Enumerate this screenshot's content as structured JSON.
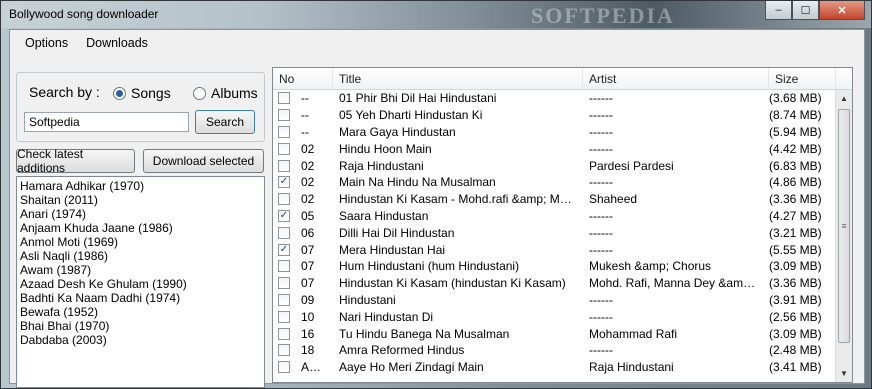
{
  "window": {
    "title": "Bollywood song downloader",
    "watermark": "SOFTPEDIA",
    "minimize": "–",
    "maximize": "☐",
    "close": "✕"
  },
  "menu": {
    "items": [
      "Options",
      "Downloads"
    ]
  },
  "search": {
    "label": "Search by :",
    "option_songs": "Songs",
    "option_albums": "Albums",
    "selected": "Songs",
    "value": "Softpedia",
    "button": "Search"
  },
  "actions": {
    "check_latest": "Check latest additions",
    "download_selected": "Download selected"
  },
  "albums": [
    "Hamara Adhikar (1970)",
    "Shaitan (2011)",
    "Anari (1974)",
    "Anjaam Khuda Jaane (1986)",
    "Anmol Moti (1969)",
    "Asli Naqli (1986)",
    "Awam (1987)",
    "Azaad Desh Ke Ghulam (1990)",
    "Badhti Ka Naam Dadhi (1974)",
    "Bewafa (1952)",
    "Bhai Bhai (1970)",
    "Dabdaba (2003)"
  ],
  "table": {
    "columns": [
      "No",
      "Title",
      "Artist",
      "Size"
    ],
    "rows": [
      {
        "checked": false,
        "no": "--",
        "title": "01 Phir Bhi Dil Hai Hindustani",
        "artist": "------",
        "size": "(3.68 MB)"
      },
      {
        "checked": false,
        "no": "--",
        "title": "05 Yeh Dharti Hindustan Ki",
        "artist": "------",
        "size": "(8.74 MB)"
      },
      {
        "checked": false,
        "no": "--",
        "title": "Mara Gaya Hindustan",
        "artist": "------",
        "size": "(5.94 MB)"
      },
      {
        "checked": false,
        "no": "02",
        "title": "Hindu Hoon Main",
        "artist": "------",
        "size": "(4.42 MB)"
      },
      {
        "checked": false,
        "no": "02",
        "title": "Raja Hindustani",
        "artist": "Pardesi Pardesi",
        "size": "(6.83 MB)"
      },
      {
        "checked": true,
        "no": "02",
        "title": "Main Na Hindu Na Musalman",
        "artist": "------",
        "size": "(4.86 MB)"
      },
      {
        "checked": false,
        "no": "02",
        "title": "Hindustan Ki Kasam - Mohd.rafi &amp; Manna D...",
        "artist": "Shaheed",
        "size": "(3.36 MB)"
      },
      {
        "checked": true,
        "no": "05",
        "title": "Saara Hindustan",
        "artist": "------",
        "size": "(4.27 MB)"
      },
      {
        "checked": false,
        "no": "06",
        "title": "Dilli Hai Dil Hindustan",
        "artist": "------",
        "size": "(3.21 MB)"
      },
      {
        "checked": true,
        "no": "07",
        "title": "Mera Hindustan Hai",
        "artist": "------",
        "size": "(5.55 MB)"
      },
      {
        "checked": false,
        "no": "07",
        "title": "Hum Hindustani (hum Hindustani)",
        "artist": "Mukesh &amp; Chorus",
        "size": "(3.09 MB)"
      },
      {
        "checked": false,
        "no": "07",
        "title": "Hindustan Ki Kasam (hindustan Ki Kasam)",
        "artist": "Mohd. Rafi, Manna Dey &amp; Ch...",
        "size": "(3.36 MB)"
      },
      {
        "checked": false,
        "no": "09",
        "title": "Hindustani",
        "artist": "------",
        "size": "(3.91 MB)"
      },
      {
        "checked": false,
        "no": "10",
        "title": "Nari Hindustan Di",
        "artist": "------",
        "size": "(2.56 MB)"
      },
      {
        "checked": false,
        "no": "16",
        "title": "Tu Hindu Banega Na Musalman",
        "artist": "Mohammad Rafi",
        "size": "(3.09 MB)"
      },
      {
        "checked": false,
        "no": "18",
        "title": "Amra Reformed Hindus",
        "artist": "------",
        "size": "(2.48 MB)"
      },
      {
        "checked": false,
        "no": "Aamir",
        "title": "Aaye Ho Meri Zindagi Main",
        "artist": "Raja Hindustani",
        "size": "(3.41 MB)"
      }
    ]
  },
  "icons": {
    "scroll_up": "▲",
    "scroll_down": "▼",
    "grip": "≡",
    "check": "✓"
  }
}
